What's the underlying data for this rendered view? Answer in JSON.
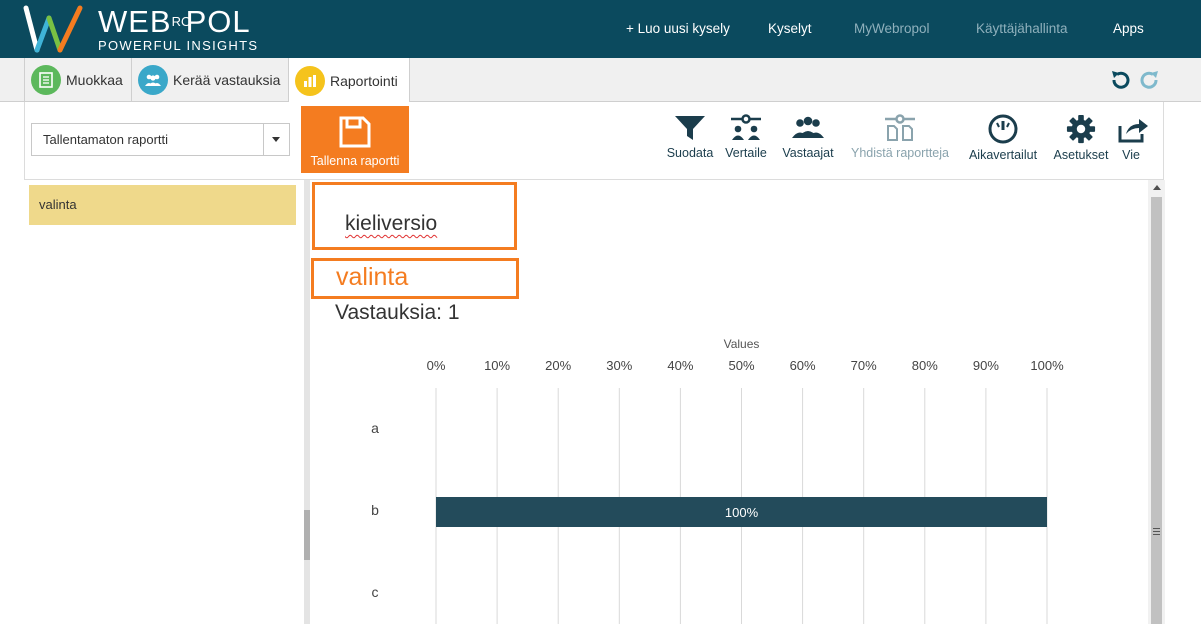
{
  "app": {
    "logo_main": "WEB",
    "logo_ro": "RO",
    "logo_end": "POL",
    "logo_sub": "POWERFUL INSIGHTS"
  },
  "topnav": [
    {
      "label": "+ Luo uusi kysely",
      "dim": false
    },
    {
      "label": "Kyselyt",
      "dim": false
    },
    {
      "label": "MyWebropol",
      "dim": true
    },
    {
      "label": "Käyttäjähallinta",
      "dim": true
    },
    {
      "label": "Apps",
      "dim": false
    }
  ],
  "tabs": [
    {
      "label": "Muokkaa",
      "icon": "document-icon",
      "color": "#5cb85c"
    },
    {
      "label": "Kerää vastauksia",
      "icon": "people-icon",
      "color": "#3aa8c9"
    },
    {
      "label": "Raportointi",
      "icon": "bar-chart-icon",
      "color": "#f5c31c"
    }
  ],
  "toolbar": {
    "report_select": "Tallentamaton raportti",
    "save_label": "Tallenna raportti",
    "tools": [
      {
        "label": "Suodata",
        "icon": "filter-icon",
        "dim": false
      },
      {
        "label": "Vertaile",
        "icon": "compare-icon",
        "dim": false
      },
      {
        "label": "Vastaajat",
        "icon": "respondents-icon",
        "dim": false
      },
      {
        "label": "Yhdistä raportteja",
        "icon": "merge-reports-icon",
        "dim": true
      },
      {
        "label": "Aikavertailut",
        "icon": "time-comparison-icon",
        "dim": false
      },
      {
        "label": "Asetukset",
        "icon": "settings-gear-icon",
        "dim": false
      },
      {
        "label": "Vie",
        "icon": "export-icon",
        "dim": false
      }
    ]
  },
  "left_panel": {
    "items": [
      "valinta"
    ]
  },
  "content": {
    "question_title": "kieliversio",
    "question_name": "valinta",
    "responses": "Vastauksia: 1"
  },
  "colors": {
    "brand_dark": "#0b4a5e",
    "accent_orange": "#f47c20",
    "bar_fill": "#234b5b",
    "selected_item": "#efd98b"
  },
  "chart_data": {
    "type": "bar",
    "orientation": "horizontal",
    "axis_title": "Values",
    "ticks": [
      "0%",
      "10%",
      "20%",
      "30%",
      "40%",
      "50%",
      "60%",
      "70%",
      "80%",
      "90%",
      "100%"
    ],
    "categories": [
      "a",
      "b",
      "c"
    ],
    "values": [
      0,
      100,
      0
    ],
    "value_labels": [
      "",
      "100%",
      ""
    ],
    "xlim": [
      0,
      100
    ],
    "grid": true
  }
}
